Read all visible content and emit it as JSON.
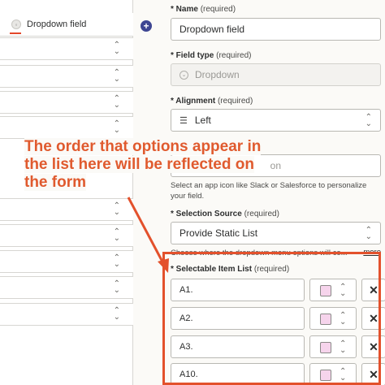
{
  "canvas": {
    "field_header_label": "Dropdown field",
    "field_header_icon": "dropdown-field-icon",
    "row_count": 10
  },
  "add_button": {
    "icon": "plus-icon",
    "label": "+"
  },
  "form": {
    "name": {
      "label": "* Name",
      "required": "(required)",
      "value": "Dropdown field"
    },
    "field_type": {
      "label": "* Field type",
      "required": "(required)",
      "value": "Dropdown",
      "icon": "dropdown-icon"
    },
    "alignment": {
      "label": "* Alignment",
      "required": "(required)",
      "value": "Left",
      "icon": "align-left-icon"
    },
    "icon_field": {
      "value_fragment": "on",
      "help": "Select an app icon like Slack or Salesforce to personalize your field."
    },
    "selection_source": {
      "label": "* Selection Source",
      "required": "(required)",
      "value": "Provide Static List",
      "help": "Choose where the dropdown menu options will co...",
      "more": "more"
    },
    "selectable_items": {
      "label": "* Selectable Item List",
      "required": "(required)",
      "items": [
        {
          "value": "A1.",
          "color": "#f6d4ec"
        },
        {
          "value": "A2.",
          "color": "#f6d4ec"
        },
        {
          "value": "A3.",
          "color": "#f6d4ec"
        },
        {
          "value": "A10.",
          "color": "#f6d4ec"
        }
      ],
      "delete_label": "✕"
    }
  },
  "annotation": {
    "text": "The order that options appear in the list here will be reflected on the form",
    "color": "#e05a2e"
  },
  "colors": {
    "accent": "#e3512c",
    "add_button": "#3d4592",
    "panel_bg": "#fbfaf7"
  }
}
